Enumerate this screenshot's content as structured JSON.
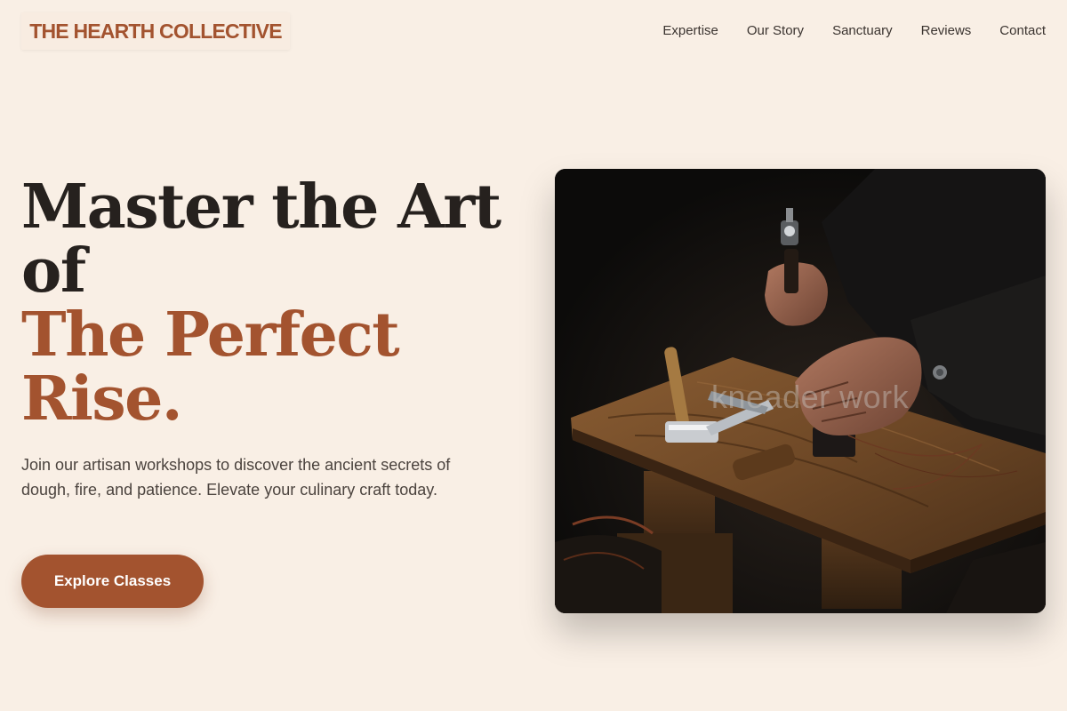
{
  "brand": {
    "name": "THE HEARTH COLLECTIVE"
  },
  "nav": {
    "items": [
      {
        "label": "Expertise"
      },
      {
        "label": "Our Story"
      },
      {
        "label": "Sanctuary"
      },
      {
        "label": "Reviews"
      },
      {
        "label": "Contact"
      }
    ]
  },
  "hero": {
    "title_line1": "Master the Art",
    "title_line2": "of",
    "title_accent1": "The Perfect",
    "title_accent2": "Rise.",
    "description": "Join our artisan workshops to discover the ancient secrets of dough, fire, and patience. Elevate your culinary craft today.",
    "cta_label": "Explore Classes",
    "image_watermark": "kneader work"
  },
  "colors": {
    "background": "#f9efe5",
    "accent": "#a3532f",
    "text": "#26211e"
  }
}
